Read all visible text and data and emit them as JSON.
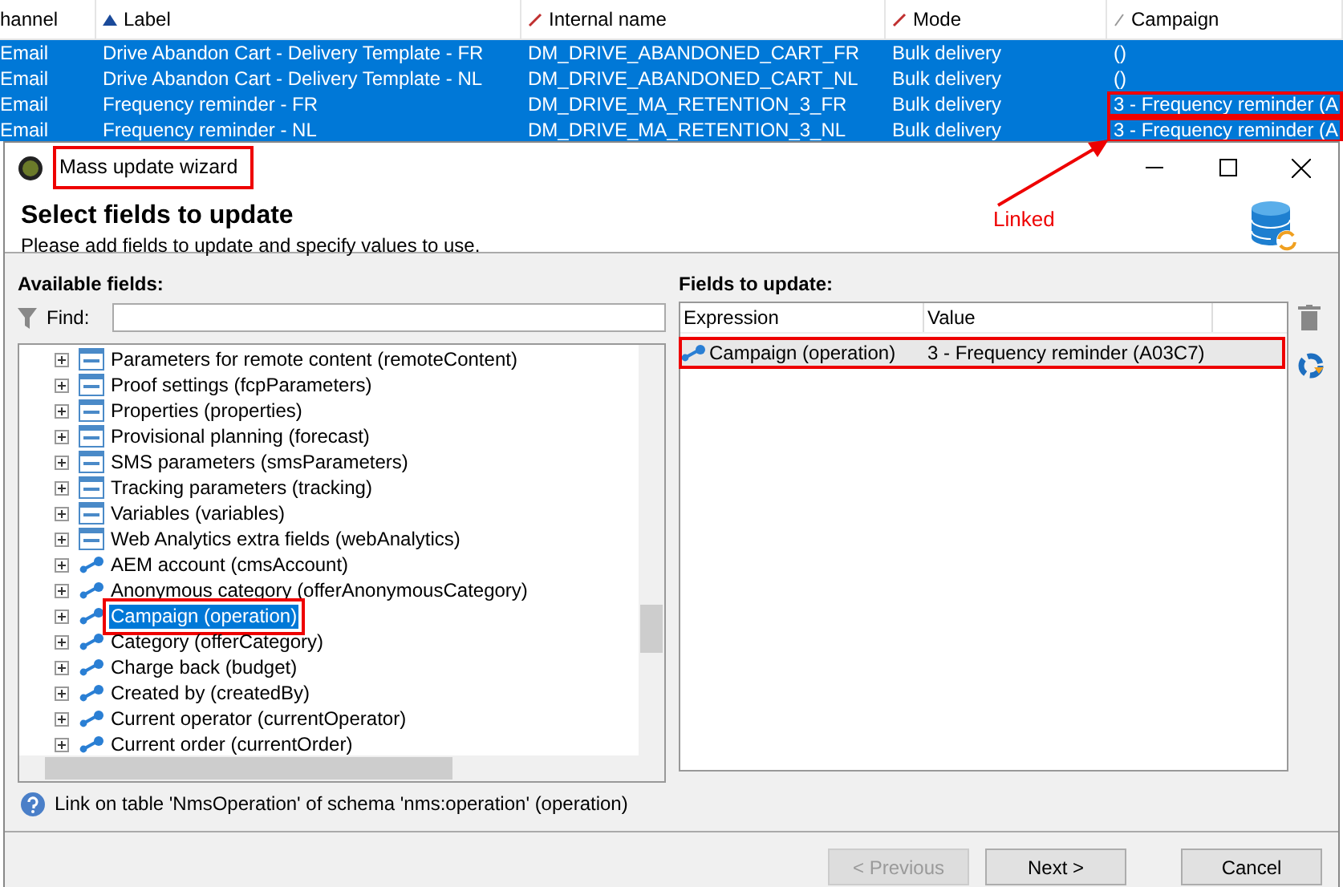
{
  "background_table": {
    "columns": [
      {
        "label": "hannel",
        "kind": "plain"
      },
      {
        "label": "Label",
        "kind": "sorted"
      },
      {
        "label": "Internal name",
        "kind": "editable"
      },
      {
        "label": "Mode",
        "kind": "editable"
      },
      {
        "label": "Campaign",
        "kind": "readonly"
      }
    ],
    "rows": [
      {
        "cells": [
          "Email",
          "Drive Abandon Cart - Delivery Template - FR",
          "DM_DRIVE_ABANDONED_CART_FR",
          "Bulk delivery",
          "()"
        ],
        "selected": true,
        "annotated": false
      },
      {
        "cells": [
          "Email",
          "Drive Abandon Cart - Delivery Template - NL",
          "DM_DRIVE_ABANDONED_CART_NL",
          "Bulk delivery",
          "()"
        ],
        "selected": true,
        "annotated": false
      },
      {
        "cells": [
          "Email",
          "Frequency reminder - FR",
          "DM_DRIVE_MA_RETENTION_3_FR",
          "Bulk delivery",
          "3 - Frequency reminder (A"
        ],
        "selected": true,
        "annotated": true
      },
      {
        "cells": [
          "Email",
          "Frequency reminder - NL",
          "DM_DRIVE_MA_RETENTION_3_NL",
          "Bulk delivery",
          "3 - Frequency reminder (A"
        ],
        "selected": true,
        "annotated": true
      }
    ]
  },
  "window": {
    "title": "Mass update wizard",
    "title_annotated": true
  },
  "header": {
    "heading": "Select fields to update",
    "subtitle": "Please add fields to update and specify values to use."
  },
  "annotation": {
    "label": "Linked"
  },
  "available_fields": {
    "label": "Available fields:",
    "find_label": "Find:",
    "items": [
      {
        "label": "Parameters for remote content (remoteContent)",
        "kind": "struct",
        "selected": false
      },
      {
        "label": "Proof settings (fcpParameters)",
        "kind": "struct",
        "selected": false
      },
      {
        "label": "Properties (properties)",
        "kind": "struct",
        "selected": false
      },
      {
        "label": "Provisional planning (forecast)",
        "kind": "struct",
        "selected": false
      },
      {
        "label": "SMS parameters (smsParameters)",
        "kind": "struct",
        "selected": false
      },
      {
        "label": "Tracking parameters (tracking)",
        "kind": "struct",
        "selected": false
      },
      {
        "label": "Variables (variables)",
        "kind": "struct",
        "selected": false
      },
      {
        "label": "Web Analytics extra fields (webAnalytics)",
        "kind": "struct",
        "selected": false
      },
      {
        "label": "AEM account (cmsAccount)",
        "kind": "link",
        "selected": false
      },
      {
        "label": "Anonymous category (offerAnonymousCategory)",
        "kind": "link",
        "selected": false
      },
      {
        "label": "Campaign (operation)",
        "kind": "link",
        "selected": true
      },
      {
        "label": "Category (offerCategory)",
        "kind": "link",
        "selected": false
      },
      {
        "label": "Charge back (budget)",
        "kind": "link",
        "selected": false
      },
      {
        "label": "Created by (createdBy)",
        "kind": "link",
        "selected": false
      },
      {
        "label": "Current operator (currentOperator)",
        "kind": "link",
        "selected": false
      },
      {
        "label": "Current order (currentOrder)",
        "kind": "link",
        "selected": false
      }
    ]
  },
  "fields_to_update": {
    "label": "Fields to update:",
    "columns": [
      "Expression",
      "Value"
    ],
    "rows": [
      {
        "expression": "Campaign (operation)",
        "value": "3 - Frequency reminder (A03C7)",
        "selected": true
      }
    ]
  },
  "info": "Link on table 'NmsOperation' of schema 'nms:operation' (operation)",
  "buttons": [
    {
      "label": "< Previous",
      "disabled": true
    },
    {
      "label": "Next >",
      "disabled": false
    },
    {
      "label": "Cancel",
      "disabled": false
    }
  ]
}
